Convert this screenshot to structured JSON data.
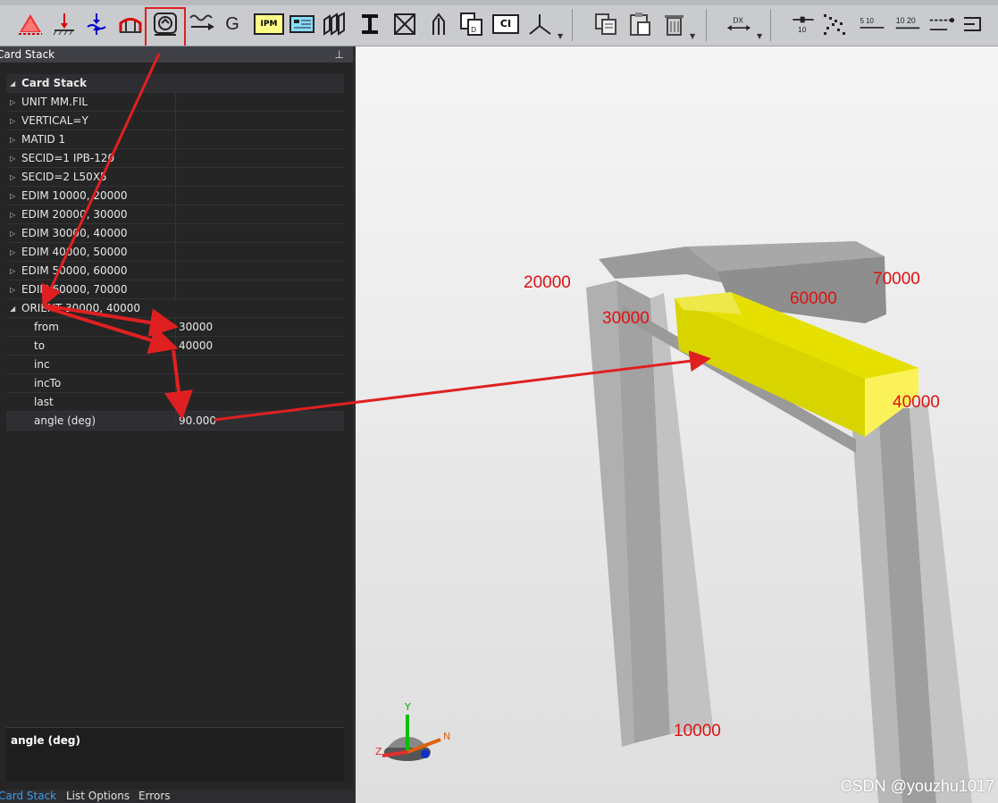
{
  "toolbar": {
    "icons": [
      "support-icon",
      "load-icon",
      "sea-icon",
      "bridge-icon",
      "orient-icon",
      "wave-icon",
      "gravity-icon",
      "ipm-icon",
      "display-icon",
      "beam-group-icon",
      "ibeam-icon",
      "cross-brace-icon",
      "arrow-up-icon",
      "copy-icon",
      "ci-icon",
      "axis-icon",
      "paste-copy-icon",
      "clipboard-icon",
      "delete-icon",
      "dx-icon",
      "slider-icon",
      "dots-icon",
      "numbers-icon",
      "list-icon"
    ],
    "g_label": "G",
    "ipm_label": "IPM",
    "ci_label": "CI",
    "dx_label": "DX",
    "num10": "10",
    "num510": "5 10",
    "num1020": "10 20"
  },
  "panel": {
    "title": "Card Stack",
    "pin_icon": "pin-icon"
  },
  "card_stack": {
    "header": "Card Stack",
    "rows": [
      {
        "label": "UNIT MM.FIL",
        "value": ""
      },
      {
        "label": "VERTICAL=Y",
        "value": ""
      },
      {
        "label": "MATID 1",
        "value": ""
      },
      {
        "label": "SECID=1 IPB-120",
        "value": ""
      },
      {
        "label": "SECID=2 L50X5",
        "value": ""
      },
      {
        "label": "EDIM 10000, 20000",
        "value": ""
      },
      {
        "label": "EDIM 20000, 30000",
        "value": ""
      },
      {
        "label": "EDIM 30000, 40000",
        "value": ""
      },
      {
        "label": "EDIM 40000, 50000",
        "value": ""
      },
      {
        "label": "EDIM 50000, 60000",
        "value": ""
      },
      {
        "label": "EDIM 60000, 70000",
        "value": ""
      }
    ],
    "orient": {
      "label": "ORIENT 30000, 40000",
      "children": [
        {
          "label": "from",
          "value": "30000"
        },
        {
          "label": "to",
          "value": "40000"
        },
        {
          "label": "inc",
          "value": ""
        },
        {
          "label": "incTo",
          "value": ""
        },
        {
          "label": "last",
          "value": ""
        },
        {
          "label": "angle (deg)",
          "value": "90.000"
        }
      ]
    }
  },
  "description": {
    "title": "angle (deg)"
  },
  "tabs": [
    {
      "label": "Card Stack",
      "active": true
    },
    {
      "label": "List Options",
      "active": false
    },
    {
      "label": "Errors",
      "active": false
    }
  ],
  "viewport": {
    "node_labels": {
      "n20000": "20000",
      "n30000": "30000",
      "n60000": "60000",
      "n70000": "70000",
      "n40000": "40000",
      "n10000": "10000"
    },
    "axes": {
      "y": "Y",
      "z": "Z",
      "n": "N"
    },
    "watermark": "CSDN @youzhu1017"
  },
  "colors": {
    "highlight": "#e02020",
    "beam": "#b4b4b4",
    "yellow_member": "#e6e000",
    "label_red": "#e01010"
  }
}
